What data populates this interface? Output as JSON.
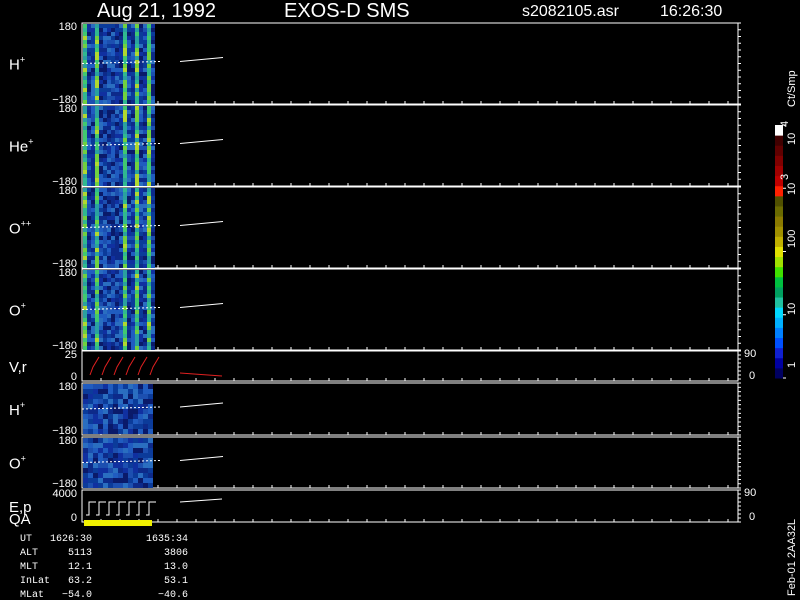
{
  "header": {
    "date": "Aug 21, 1992",
    "instrument": "EXOS-D SMS",
    "filename": "s2082105.asr",
    "time": "16:26:30"
  },
  "colorbar": {
    "title": "Ct/Smp",
    "tick_labels": [
      "1",
      "10",
      "100",
      "10",
      "3",
      "10",
      "4"
    ],
    "colors": [
      "#000060",
      "#0000a0",
      "#1020d0",
      "#0050ff",
      "#0080ff",
      "#00b0ff",
      "#00d8ff",
      "#20c0a0",
      "#00a060",
      "#00c040",
      "#40e000",
      "#a0e000",
      "#e0e000",
      "#c0b000",
      "#a09000",
      "#8a7a00",
      "#6a6a00",
      "#505000",
      "#ff2000",
      "#c00000",
      "#a00000",
      "#800000",
      "#600000",
      "#400000",
      "#ffffff"
    ]
  },
  "panels": [
    {
      "label": "H",
      "sup": "+",
      "ymax": "180",
      "ymin": "−180",
      "type": "spectrogram"
    },
    {
      "label": "He",
      "sup": "+",
      "ymax": "180",
      "ymin": "−180",
      "type": "spectrogram"
    },
    {
      "label": "O",
      "sup": "++",
      "ymax": "180",
      "ymin": "−180",
      "type": "spectrogram"
    },
    {
      "label": "O",
      "sup": "+",
      "ymax": "180",
      "ymin": "−180",
      "type": "spectrogram"
    },
    {
      "label": "V",
      "sub": ",r",
      "ymax": "25",
      "ymin": "0",
      "rtop": "90",
      "rbot": "0",
      "type": "line"
    },
    {
      "label": "H",
      "sup": "+",
      "ymax": "180",
      "ymin": "−180",
      "type": "spectrogram2"
    },
    {
      "label": "O",
      "sup": "+",
      "ymax": "180",
      "ymin": "−180",
      "type": "spectrogram2"
    },
    {
      "label": "E,p",
      "label2": "QA",
      "ymax": "4000",
      "ymin": "0",
      "rtop": "90",
      "rbot": "0",
      "type": "step"
    }
  ],
  "footer": {
    "rows": [
      {
        "name": "UT",
        "v1": "1626:30",
        "v2": "1635:34"
      },
      {
        "name": "ALT",
        "v1": "5113",
        "v2": "3806"
      },
      {
        "name": "MLT",
        "v1": "12.1",
        "v2": "13.0"
      },
      {
        "name": "InLat",
        "v1": "63.2",
        "v2": "53.1"
      },
      {
        "name": "MLat",
        "v1": "−54.0",
        "v2": "−40.6"
      }
    ],
    "side_note": "Feb-01 2AA32L"
  },
  "chart_data": {
    "type": "heatmap",
    "title": "Aug 21, 1992   EXOS-D SMS",
    "subtitle": "s2082105.asr  16:26:30",
    "time_range": [
      "1626:30",
      "1635:34"
    ],
    "panels": [
      "H+",
      "He+",
      "O++",
      "O+",
      "V,r",
      "H+",
      "O+",
      "E,p / QA"
    ],
    "pitch_angle_range": [
      -180,
      180
    ],
    "colorbar_range": [
      1,
      10000
    ],
    "colorbar_scale": "log",
    "colorbar_unit": "Ct/Smp",
    "data_fraction_of_axis": 0.17
  }
}
